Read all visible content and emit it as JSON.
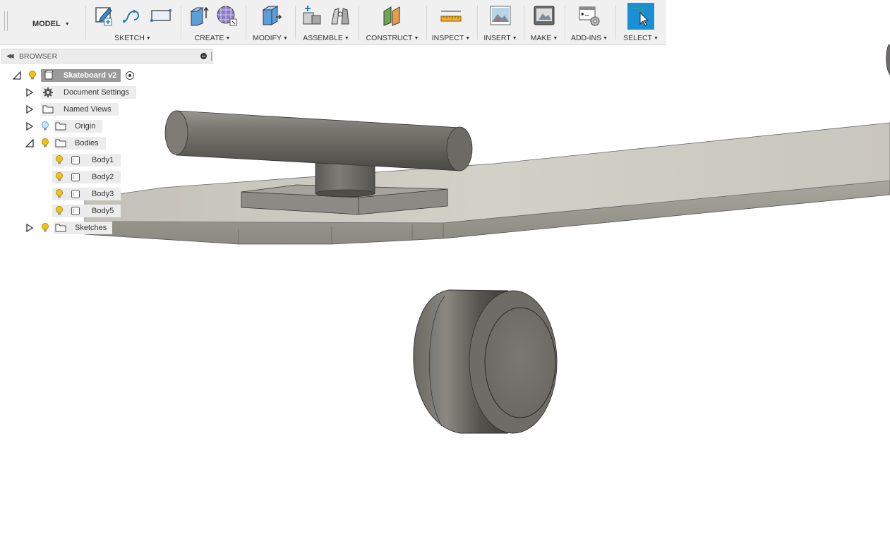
{
  "toolbar": {
    "workspace": "MODEL",
    "groups": [
      {
        "id": "sketch",
        "label": "SKETCH"
      },
      {
        "id": "create",
        "label": "CREATE"
      },
      {
        "id": "modify",
        "label": "MODIFY"
      },
      {
        "id": "assemble",
        "label": "ASSEMBLE"
      },
      {
        "id": "construct",
        "label": "CONSTRUCT"
      },
      {
        "id": "inspect",
        "label": "INSPECT"
      },
      {
        "id": "insert",
        "label": "INSERT"
      },
      {
        "id": "make",
        "label": "MAKE"
      },
      {
        "id": "addins",
        "label": "ADD-INS"
      },
      {
        "id": "select",
        "label": "SELECT"
      }
    ],
    "caret": "▼"
  },
  "browser": {
    "title": "BROWSER",
    "root": "Skateboard v2",
    "items": [
      {
        "label": "Document Settings"
      },
      {
        "label": "Named Views"
      },
      {
        "label": "Origin"
      },
      {
        "label": "Bodies"
      },
      {
        "label": "Sketches"
      }
    ],
    "bodies": [
      {
        "label": "Body1"
      },
      {
        "label": "Body2"
      },
      {
        "label": "Body3"
      },
      {
        "label": "Body5"
      }
    ]
  },
  "colors": {
    "toolbar_bg": "#f0f0f0",
    "accent": "#1a8fd6",
    "bulb_on": "#f2c21a",
    "bulb_off": "#5aa3e0",
    "model_gray": "#6e6c66",
    "deck_top": "#c9c6bd"
  }
}
